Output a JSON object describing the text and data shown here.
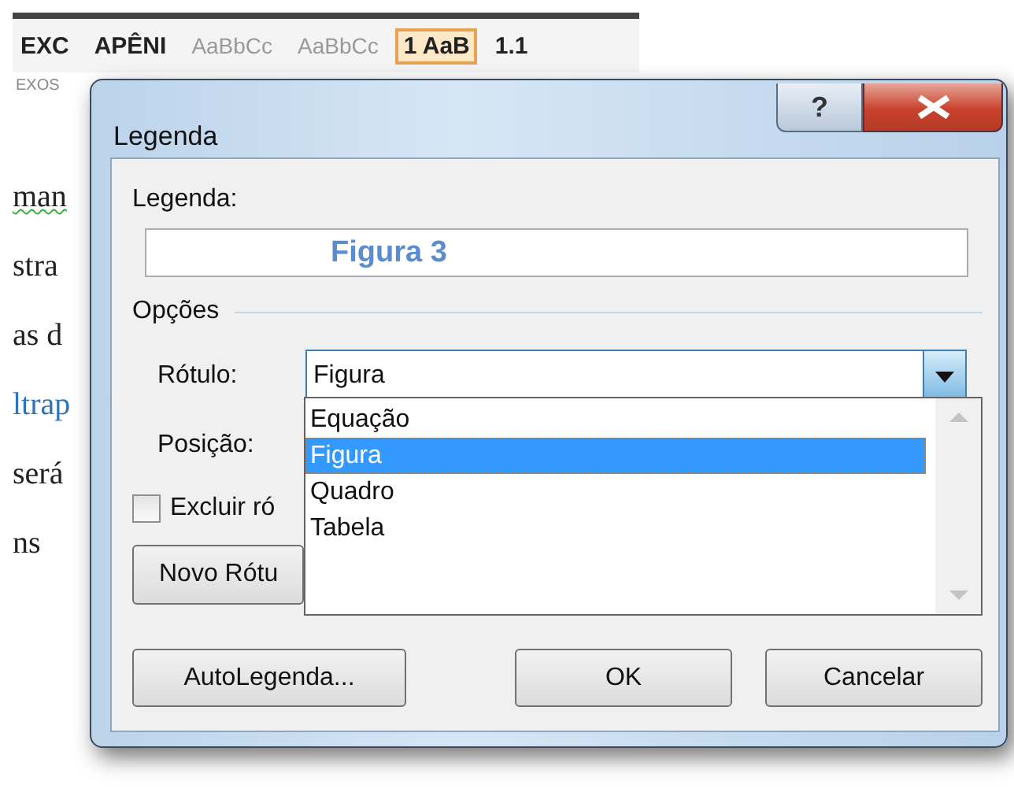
{
  "document": {
    "ribbon_styles": [
      {
        "label": "EXC",
        "kind": "heading",
        "selected": false
      },
      {
        "label": "APÊNI",
        "kind": "heading",
        "selected": false
      },
      {
        "label": "AaBbCc",
        "kind": "normal",
        "selected": false
      },
      {
        "label": "AaBbCc",
        "kind": "normal",
        "selected": false
      },
      {
        "label": "1 AaB",
        "kind": "heading",
        "selected": true
      },
      {
        "label": "1.1",
        "kind": "heading",
        "selected": false
      }
    ],
    "ribbon_caption": "EXOS",
    "lines": [
      {
        "text": "man",
        "kind": "spelling"
      },
      {
        "text": "stra",
        "kind": "plain"
      },
      {
        "text": "as d",
        "kind": "plain"
      },
      {
        "text": "ltrap",
        "kind": "link"
      },
      {
        "text": "será",
        "kind": "plain"
      },
      {
        "text": "ns",
        "kind": "plain"
      }
    ]
  },
  "dialog": {
    "title": "Legenda",
    "help_button": "?",
    "caption_label": "Legenda:",
    "caption_value": "Figura 3",
    "options_heading": "Opções",
    "label_field": {
      "label": "Rótulo:",
      "value": "Figura",
      "expanded": true
    },
    "position_label": "Posição:",
    "exclude": {
      "label": "Excluir ró",
      "checked": false
    },
    "new_label_button": "Novo Rótu",
    "dropdown_items": [
      {
        "label": "Equação",
        "selected": false
      },
      {
        "label": "Figura",
        "selected": true
      },
      {
        "label": "Quadro",
        "selected": false
      },
      {
        "label": "Tabela",
        "selected": false
      }
    ],
    "buttons": [
      {
        "label": "AutoLegenda...",
        "kind": "left"
      },
      {
        "label": "OK",
        "kind": "right"
      },
      {
        "label": "Cancelar",
        "kind": "right"
      }
    ]
  }
}
